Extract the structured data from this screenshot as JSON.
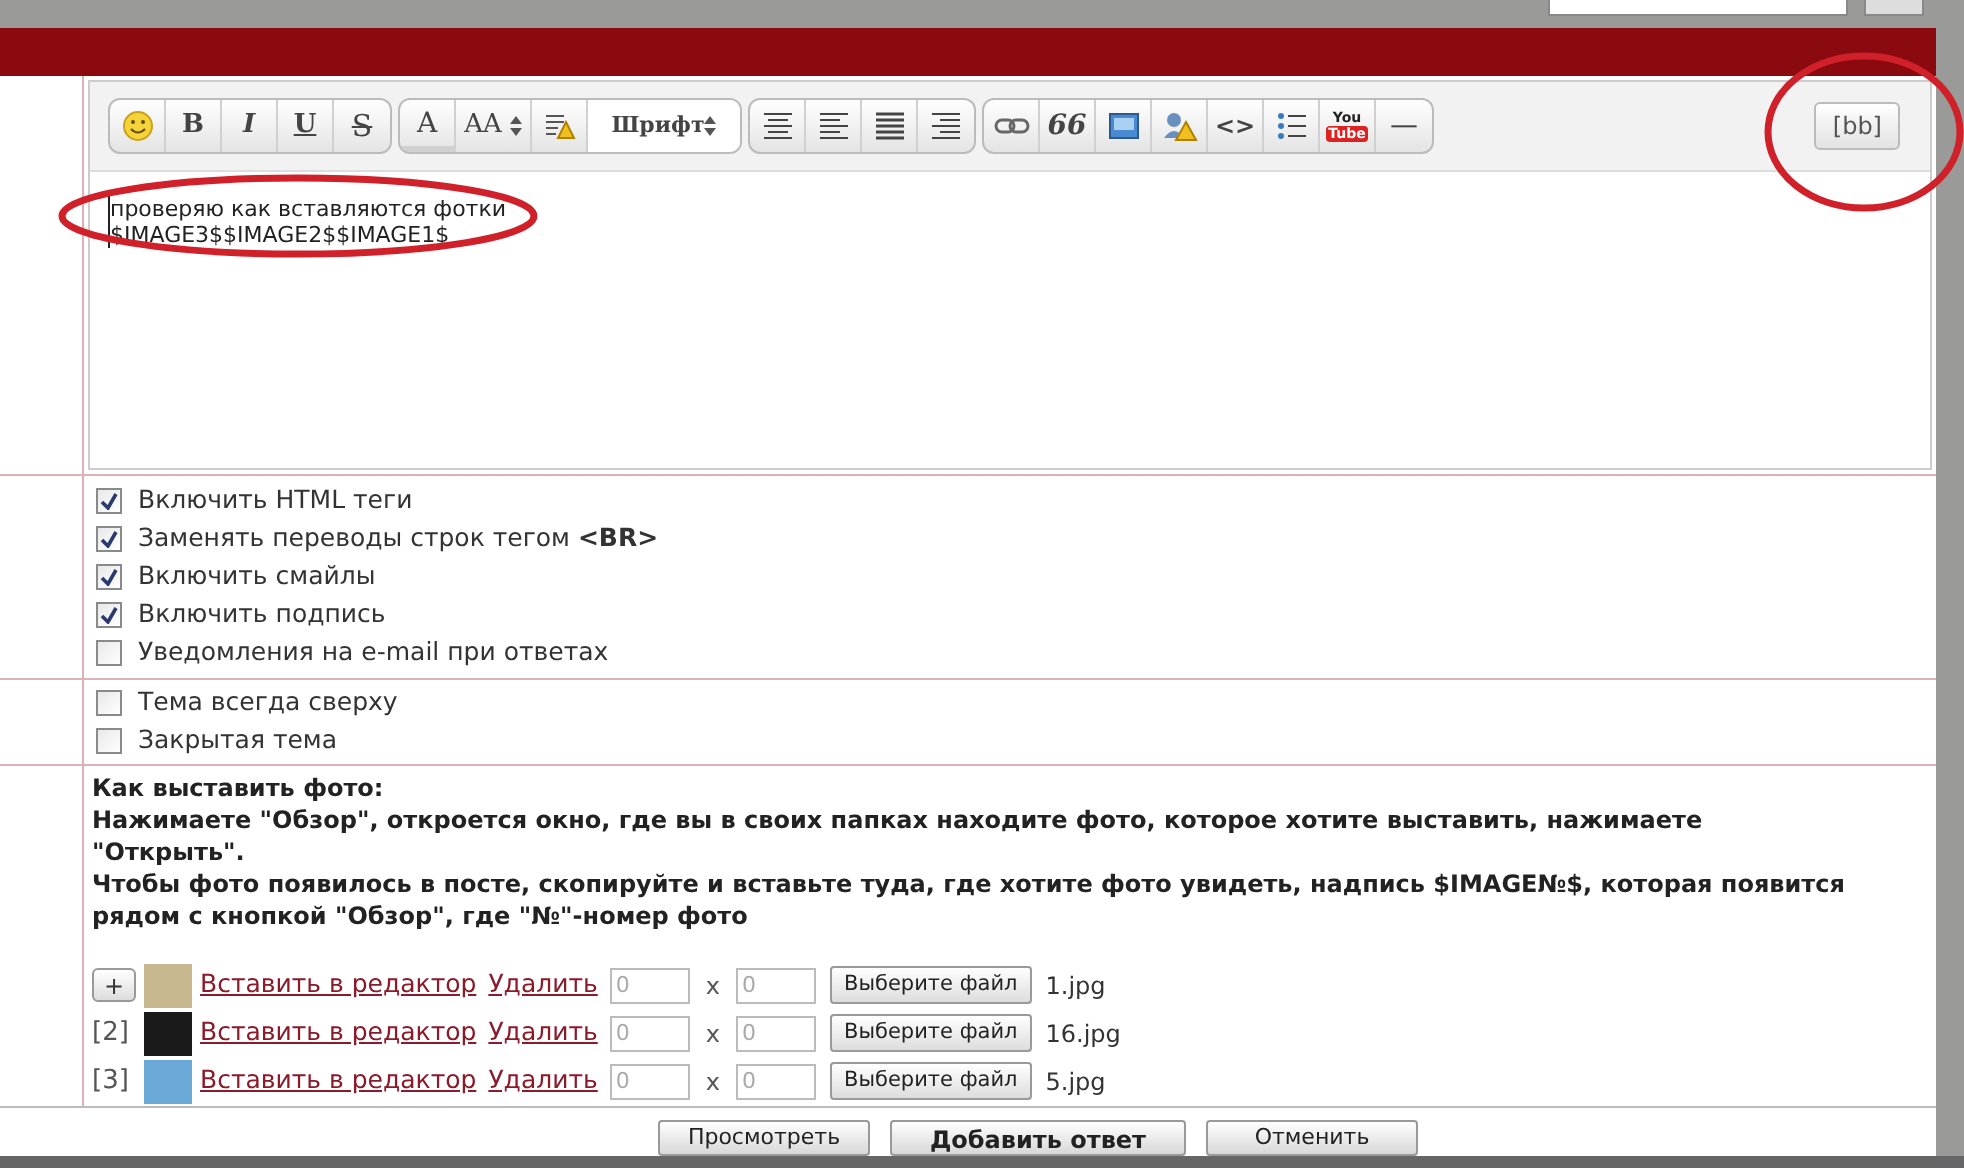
{
  "toolbar": {
    "groups": [
      [
        {
          "kind": "smiley"
        },
        {
          "kind": "bold",
          "label": "B"
        },
        {
          "kind": "italic",
          "label": "I"
        },
        {
          "kind": "underline",
          "label": "U"
        },
        {
          "kind": "strike",
          "label": "S"
        }
      ],
      [
        {
          "kind": "color",
          "label": "A"
        },
        {
          "kind": "spinner",
          "label": "AA"
        },
        {
          "kind": "highlight"
        },
        {
          "kind": "select",
          "label": "Шрифт"
        }
      ],
      [
        {
          "kind": "align-center"
        },
        {
          "kind": "align-left"
        },
        {
          "kind": "align-justify"
        },
        {
          "kind": "align-right"
        }
      ],
      [
        {
          "kind": "link"
        },
        {
          "kind": "quote",
          "label": "66"
        },
        {
          "kind": "image"
        },
        {
          "kind": "user-warning"
        },
        {
          "kind": "code",
          "label": "<>"
        },
        {
          "kind": "list"
        },
        {
          "kind": "youtube",
          "label": "You",
          "sublabel": "Tube"
        },
        {
          "kind": "rule",
          "label": "—"
        }
      ]
    ],
    "mode_button": "[bb]"
  },
  "editor_lines": [
    "проверяю как вставляются фотки",
    "$IMAGE3$$IMAGE2$$IMAGE1$"
  ],
  "post_options": [
    {
      "label": "Включить HTML теги",
      "checked": true
    },
    {
      "label": "Заменять переводы строк тегом **<BR>**",
      "checked": true
    },
    {
      "label": "Включить смайлы",
      "checked": true
    },
    {
      "label": "Включить подпись",
      "checked": true
    },
    {
      "label": "Уведомления на e-mail при ответах",
      "checked": false
    }
  ],
  "topic_options": [
    {
      "label": "Тема всегда сверху",
      "checked": false
    },
    {
      "label": "Закрытая тема",
      "checked": false
    }
  ],
  "photo_help": [
    "Как выставить фото:",
    "Нажимаете \"Обзор\", откроется окно, где вы в своих папках находите фото, которое хотите выставить, нажимаете \"Открыть\".",
    "Чтобы фото появилось в посте, скопируйте и вставьте туда, где хотите фото увидеть, надпись $IMAGE№$, которая появится рядом с кнопкой \"Обзор\", где \"№\"-номер фото"
  ],
  "attachments": [
    {
      "kind": "add",
      "marker": "+",
      "insert_link": "Вставить в редактор",
      "delete_link": "Удалить",
      "width_placeholder": "0",
      "separator": "x",
      "height_placeholder": "0",
      "file_button": "Выберите файл",
      "file_name": "1.jpg"
    },
    {
      "kind": "index",
      "marker": "[2]",
      "insert_link": "Вставить в редактор",
      "delete_link": "Удалить",
      "width_placeholder": "0",
      "separator": "x",
      "height_placeholder": "0",
      "file_button": "Выберите файл",
      "file_name": "16.jpg"
    },
    {
      "kind": "index",
      "marker": "[3]",
      "insert_link": "Вставить в редактор",
      "delete_link": "Удалить",
      "width_placeholder": "0",
      "separator": "x",
      "height_placeholder": "0",
      "file_button": "Выберите файл",
      "file_name": "5.jpg"
    }
  ],
  "actions": [
    {
      "label": "Просмотреть",
      "kind": "normal"
    },
    {
      "label": "Добавить ответ",
      "kind": "primary"
    },
    {
      "label": "Отменить",
      "kind": "normal"
    }
  ]
}
